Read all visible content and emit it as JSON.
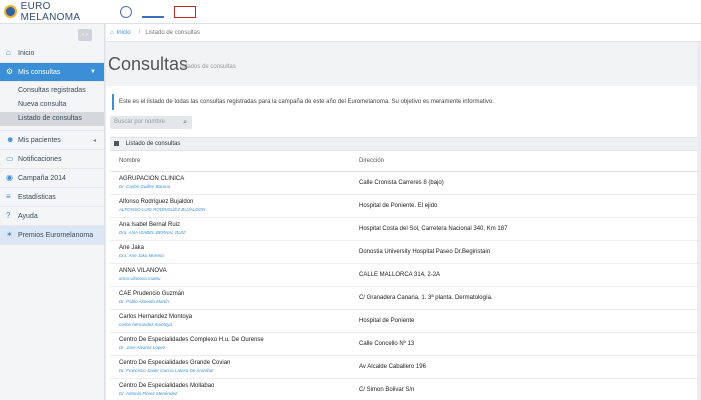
{
  "header": {
    "brand": "EURO MELANOMA",
    "partner_logos": [
      "badge-logo",
      "aedv-logo",
      "fundacion-logo"
    ]
  },
  "sidebar": {
    "collapse_icon": "‹ ›",
    "items": [
      {
        "label": "Inicio",
        "icon": "home-icon"
      },
      {
        "label": "Mis consultas",
        "icon": "gear-icon",
        "active": true
      },
      {
        "label": "Mis pacientes",
        "icon": "users-icon"
      },
      {
        "label": "Notificaciones",
        "icon": "monitor-icon"
      },
      {
        "label": "Campaña 2014",
        "icon": "pin-icon"
      },
      {
        "label": "Estadísticas",
        "icon": "stack-icon"
      },
      {
        "label": "Ayuda",
        "icon": "question-icon"
      },
      {
        "label": "Premios Euromelanoma",
        "icon": "star-icon"
      }
    ],
    "sub_items": [
      "Consultas registradas",
      "Nueva consulta",
      "Listado de consultas"
    ]
  },
  "breadcrumb": {
    "home": "Inicio",
    "current": "Listado de consultas"
  },
  "page": {
    "title": "Consultas",
    "subtitle": "listados de consultas",
    "info": "Este es el listado de todas las consultas registradas para la campaña de este año del Euromelanoma. Su objetivo es meramente informativo.",
    "search_placeholder": "Buscar por nombre"
  },
  "panel": {
    "title": "Listado de consultas",
    "columns": [
      "Nombre",
      "Dirección"
    ],
    "rows": [
      {
        "name": "AGRUPACION CLINICA",
        "doctor": "Dr. Carlos Guillen Barona",
        "address": "Calle Cronista Carreres 8 (bajo)"
      },
      {
        "name": "Alfonso Rodríguez Bujaldon",
        "doctor": "ALFONSO LUIS RODRIGUEZ BUJALDON",
        "address": "Hospital de Poniente. El ejido"
      },
      {
        "name": "Ana Isabel Bernal Ruiz",
        "doctor": "Dra. ANA ISABEL BERNAL RUIZ",
        "address": "Hospital Costa del Sol, Carretera Nacional 340, Km 187"
      },
      {
        "name": "Ane Jaka",
        "doctor": "Dra. Ane Jaka Moreno",
        "address": "Donostia University Hospital Paseo Dr.Begiristain"
      },
      {
        "name": "ANNA VILANOVA",
        "doctor": "anna vilanova mateu",
        "address": "CALLE MALLORCA 314, 2-2A"
      },
      {
        "name": "CAE Prudencio Guzmán",
        "doctor": "Dr. Pablo Almeida Martín",
        "address": "C/ Granadera Canaria, 1. 3ª planta. Dermatología."
      },
      {
        "name": "Carlos Hernandez Montoya",
        "doctor": "carlos hernandez montoya",
        "address": "Hospital de Poniente"
      },
      {
        "name": "Centro De Especialidades Complexo H.u. De Ourense",
        "doctor": "Dr. Jose Alvarez Lopez",
        "address": "Calle Concello Nº 13"
      },
      {
        "name": "Centro De Especialidades Grande Covian",
        "doctor": "Dr. Francisco Javier García Latasa De Araníbar",
        "address": "Av Alcalde Caballero 196"
      },
      {
        "name": "Centro De Especialidades Mollabao",
        "doctor": "Dr. Antonio Flórez Menéndez",
        "address": "C/ Simon Bolivar S/n"
      }
    ]
  }
}
